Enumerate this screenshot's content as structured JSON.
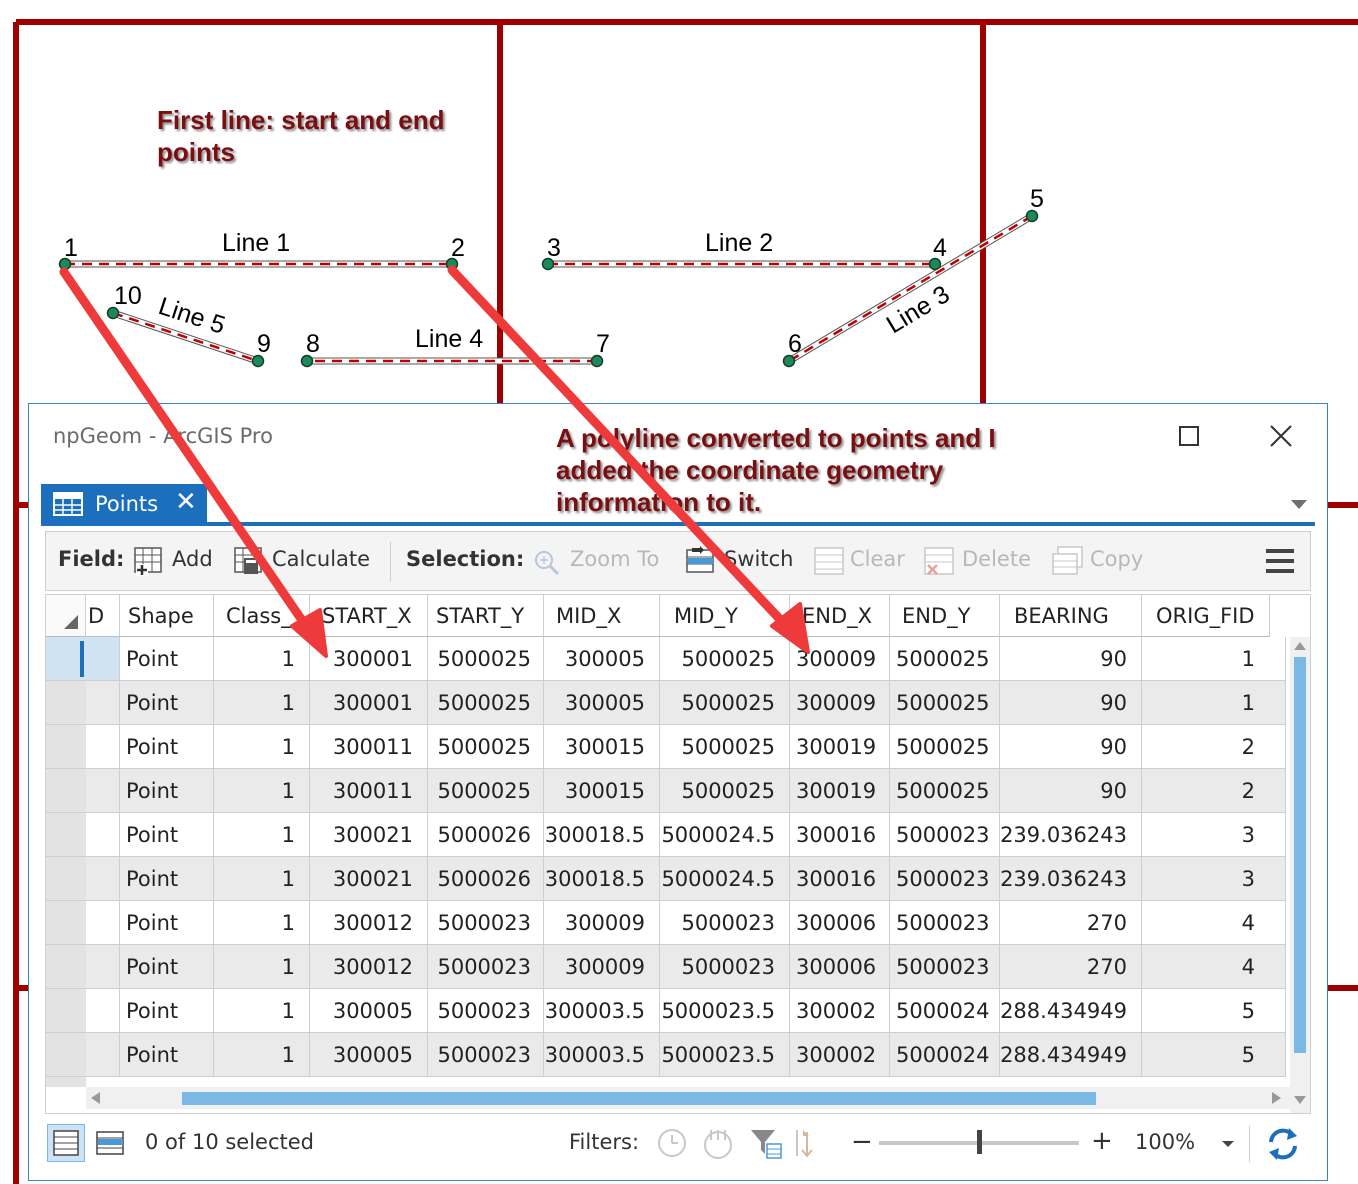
{
  "map": {
    "annotation_top": [
      "First line: start and end",
      "points"
    ],
    "annotation_window": [
      "A polyline converted to points and I",
      "added the coordinate geometry",
      "information to it."
    ],
    "point_labels": [
      "1",
      "2",
      "3",
      "4",
      "5",
      "6",
      "7",
      "8",
      "9",
      "10"
    ],
    "line_labels": [
      "Line 1",
      "Line 2",
      "Line 3",
      "Line 4",
      "Line 5"
    ],
    "colors": {
      "frame": "#a00000",
      "line_dash": "#c00000",
      "point": "#1a8a5a",
      "arrow": "#ee3a3a"
    }
  },
  "window": {
    "title": "npGeom - ArcGIS Pro",
    "maximize_icon": "maximize-icon",
    "close_icon": "close-icon"
  },
  "tab": {
    "label": "Points",
    "close": "✕"
  },
  "toolbar": {
    "field_label": "Field:",
    "add": "Add",
    "calculate": "Calculate",
    "selection_label": "Selection:",
    "zoom_to": "Zoom To",
    "switch": "Switch",
    "clear": "Clear",
    "delete": "Delete",
    "copy": "Copy"
  },
  "table": {
    "columns": [
      "D",
      "Shape",
      "Class_",
      "START_X",
      "START_Y",
      "MID_X",
      "MID_Y",
      "END_X",
      "END_Y",
      "BEARING",
      "ORIG_FID"
    ],
    "rows": [
      [
        "Point",
        "1",
        "300001",
        "5000025",
        "300005",
        "5000025",
        "300009",
        "5000025",
        "90",
        "1"
      ],
      [
        "Point",
        "1",
        "300001",
        "5000025",
        "300005",
        "5000025",
        "300009",
        "5000025",
        "90",
        "1"
      ],
      [
        "Point",
        "1",
        "300011",
        "5000025",
        "300015",
        "5000025",
        "300019",
        "5000025",
        "90",
        "2"
      ],
      [
        "Point",
        "1",
        "300011",
        "5000025",
        "300015",
        "5000025",
        "300019",
        "5000025",
        "90",
        "2"
      ],
      [
        "Point",
        "1",
        "300021",
        "5000026",
        "300018.5",
        "5000024.5",
        "300016",
        "5000023",
        "239.036243",
        "3"
      ],
      [
        "Point",
        "1",
        "300021",
        "5000026",
        "300018.5",
        "5000024.5",
        "300016",
        "5000023",
        "239.036243",
        "3"
      ],
      [
        "Point",
        "1",
        "300012",
        "5000023",
        "300009",
        "5000023",
        "300006",
        "5000023",
        "270",
        "4"
      ],
      [
        "Point",
        "1",
        "300012",
        "5000023",
        "300009",
        "5000023",
        "300006",
        "5000023",
        "270",
        "4"
      ],
      [
        "Point",
        "1",
        "300005",
        "5000023",
        "300003.5",
        "5000023.5",
        "300002",
        "5000024",
        "288.434949",
        "5"
      ],
      [
        "Point",
        "1",
        "300005",
        "5000023",
        "300003.5",
        "5000023.5",
        "300002",
        "5000024",
        "288.434949",
        "5"
      ]
    ]
  },
  "status": {
    "selected": "0 of 10 selected",
    "filters_label": "Filters:",
    "zoom": "100%",
    "zoom_minus": "−",
    "zoom_plus": "+"
  }
}
